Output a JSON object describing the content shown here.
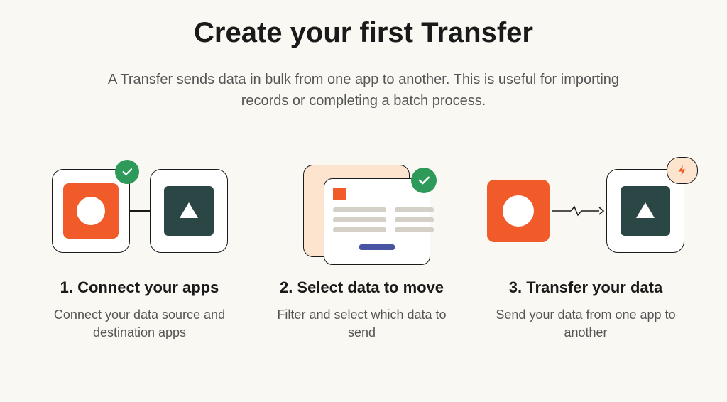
{
  "title": "Create your first Transfer",
  "subtitle": "A Transfer sends data in bulk from one app to another. This is useful for importing records or completing a batch process.",
  "steps": [
    {
      "title": "1. Connect your apps",
      "description": "Connect your data source and destination apps"
    },
    {
      "title": "2. Select data to move",
      "description": "Filter and select which data to send"
    },
    {
      "title": "3. Transfer your data",
      "description": "Send your data from one app to another"
    }
  ],
  "colors": {
    "orange": "#f15b2a",
    "teal": "#2a4645",
    "green": "#2d9a5a",
    "peach": "#fce4ce",
    "purple": "#4953a4"
  }
}
